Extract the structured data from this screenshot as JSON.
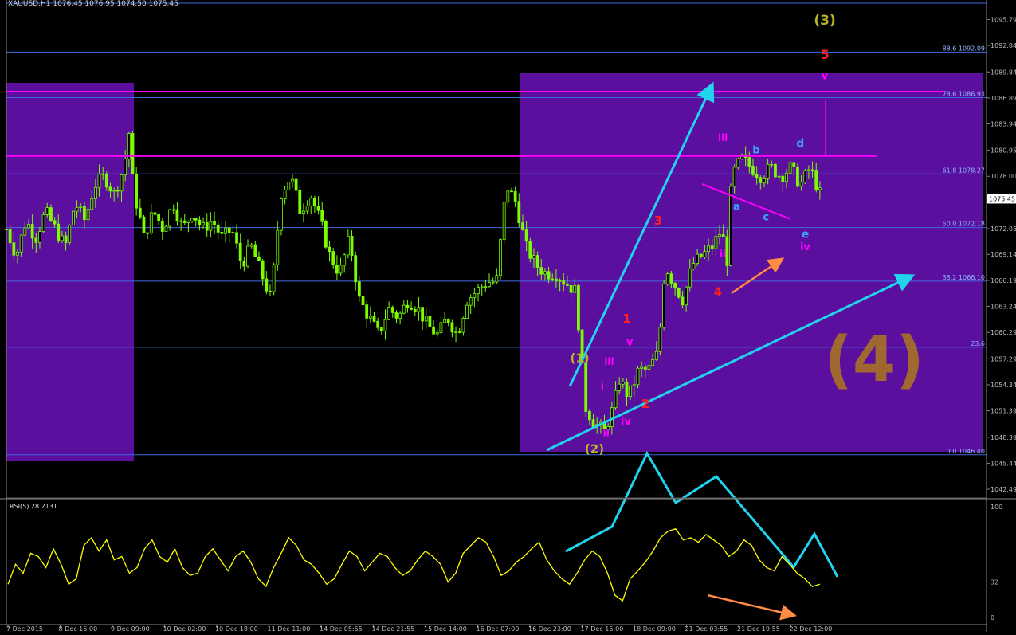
{
  "window": {
    "header": "XAUUSD,H1  1076.45 1076.95 1074.50 1075.45",
    "current_price_tag": "1075.45"
  },
  "colors": {
    "background": "#000000",
    "candles": "#7CFC00",
    "rsi_line": "#FFFF00",
    "zone_fill": "#5B0F9E",
    "fib_line": "#4169E1",
    "magenta": "#FF00FF",
    "cyan": "#22D3EE",
    "orange": "#FF8C42",
    "red_label": "#FF2020",
    "olive_label": "#B5B52A",
    "blue_label": "#3BA0FF",
    "brown_text": "#B8860B"
  },
  "chart_data": [
    {
      "type": "candlestick",
      "symbol": "XAUUSD",
      "timeframe": "H1",
      "title": "XAUUSD,H1  1076.45 1076.95 1074.50 1075.45",
      "ohlc_last": {
        "open": 1076.45,
        "high": 1076.95,
        "low": 1074.5,
        "close": 1075.45
      },
      "ylim": [
        1041.5,
        1098.0
      ],
      "y_ticks": [
        "1095.79",
        "1092.84",
        "1089.84",
        "1086.89",
        "1083.94",
        "1080.95",
        "1078.00",
        "1075.45",
        "1072.05",
        "1069.14",
        "1066.19",
        "1063.24",
        "1060.29",
        "1057.29",
        "1054.34",
        "1051.39",
        "1048.39",
        "1045.44",
        "1042.49"
      ],
      "x_ticks": [
        "7 Dec 2015",
        "8 Dec 16:00",
        "9 Dec 09:00",
        "10 Dec 02:00",
        "10 Dec 18:00",
        "11 Dec 11:00",
        "14 Dec 05:55",
        "14 Dec 21:55",
        "15 Dec 14:00",
        "16 Dec 07:00",
        "16 Dec 23:00",
        "17 Dec 16:00",
        "18 Dec 09:00",
        "21 Dec 03:55",
        "21 Dec 19:55",
        "22 Dec 12:00"
      ],
      "fib_levels": [
        {
          "label": "88.6 1092.09",
          "price": 1092.09
        },
        {
          "label": "78.6 1086.93",
          "price": 1086.93
        },
        {
          "label": "61.8 1078.27",
          "price": 1078.27
        },
        {
          "label": "50.0 1072.18",
          "price": 1072.18
        },
        {
          "label": "38.2 1066.10",
          "price": 1066.1
        },
        {
          "label": "23.6",
          "price": 1058.6
        },
        {
          "label": "0.0 1046.40",
          "price": 1046.4
        }
      ],
      "horizontal_lines": [
        {
          "price": 1087.6,
          "color": "magenta"
        },
        {
          "price": 1080.3,
          "color": "magenta"
        }
      ],
      "path": [
        {
          "x": 0.0,
          "p": 1072
        },
        {
          "x": 0.01,
          "p": 1069
        },
        {
          "x": 0.02,
          "p": 1073
        },
        {
          "x": 0.03,
          "p": 1071
        },
        {
          "x": 0.04,
          "p": 1074
        },
        {
          "x": 0.05,
          "p": 1072
        },
        {
          "x": 0.06,
          "p": 1070
        },
        {
          "x": 0.07,
          "p": 1075
        },
        {
          "x": 0.08,
          "p": 1073
        },
        {
          "x": 0.09,
          "p": 1077
        },
        {
          "x": 0.1,
          "p": 1078
        },
        {
          "x": 0.11,
          "p": 1076
        },
        {
          "x": 0.12,
          "p": 1079
        },
        {
          "x": 0.125,
          "p": 1083
        },
        {
          "x": 0.13,
          "p": 1076
        },
        {
          "x": 0.135,
          "p": 1074
        },
        {
          "x": 0.14,
          "p": 1071
        },
        {
          "x": 0.15,
          "p": 1074
        },
        {
          "x": 0.16,
          "p": 1072
        },
        {
          "x": 0.17,
          "p": 1075
        },
        {
          "x": 0.18,
          "p": 1072
        },
        {
          "x": 0.19,
          "p": 1074
        },
        {
          "x": 0.2,
          "p": 1072
        },
        {
          "x": 0.21,
          "p": 1073
        },
        {
          "x": 0.22,
          "p": 1071
        },
        {
          "x": 0.23,
          "p": 1072
        },
        {
          "x": 0.24,
          "p": 1068
        },
        {
          "x": 0.25,
          "p": 1070
        },
        {
          "x": 0.26,
          "p": 1067
        },
        {
          "x": 0.27,
          "p": 1064
        },
        {
          "x": 0.28,
          "p": 1076
        },
        {
          "x": 0.29,
          "p": 1078
        },
        {
          "x": 0.3,
          "p": 1074
        },
        {
          "x": 0.31,
          "p": 1076
        },
        {
          "x": 0.32,
          "p": 1073
        },
        {
          "x": 0.33,
          "p": 1069
        },
        {
          "x": 0.34,
          "p": 1067
        },
        {
          "x": 0.35,
          "p": 1071
        },
        {
          "x": 0.36,
          "p": 1064
        },
        {
          "x": 0.37,
          "p": 1062
        },
        {
          "x": 0.38,
          "p": 1060
        },
        {
          "x": 0.39,
          "p": 1063
        },
        {
          "x": 0.4,
          "p": 1062
        },
        {
          "x": 0.41,
          "p": 1064
        },
        {
          "x": 0.42,
          "p": 1063
        },
        {
          "x": 0.43,
          "p": 1061
        },
        {
          "x": 0.44,
          "p": 1060
        },
        {
          "x": 0.45,
          "p": 1062
        },
        {
          "x": 0.46,
          "p": 1060
        },
        {
          "x": 0.47,
          "p": 1064
        },
        {
          "x": 0.48,
          "p": 1065
        },
        {
          "x": 0.49,
          "p": 1066
        },
        {
          "x": 0.5,
          "p": 1066
        },
        {
          "x": 0.51,
          "p": 1077
        },
        {
          "x": 0.52,
          "p": 1075
        },
        {
          "x": 0.53,
          "p": 1070
        },
        {
          "x": 0.54,
          "p": 1068
        },
        {
          "x": 0.55,
          "p": 1067
        },
        {
          "x": 0.56,
          "p": 1067
        },
        {
          "x": 0.57,
          "p": 1066
        },
        {
          "x": 0.58,
          "p": 1065
        },
        {
          "x": 0.585,
          "p": 1060
        },
        {
          "x": 0.59,
          "p": 1052
        },
        {
          "x": 0.6,
          "p": 1050
        },
        {
          "x": 0.61,
          "p": 1049
        },
        {
          "x": 0.62,
          "p": 1052
        },
        {
          "x": 0.625,
          "p": 1055
        },
        {
          "x": 0.635,
          "p": 1053
        },
        {
          "x": 0.645,
          "p": 1056
        },
        {
          "x": 0.655,
          "p": 1056
        },
        {
          "x": 0.665,
          "p": 1058
        },
        {
          "x": 0.672,
          "p": 1068
        },
        {
          "x": 0.68,
          "p": 1066
        },
        {
          "x": 0.69,
          "p": 1064
        },
        {
          "x": 0.7,
          "p": 1068
        },
        {
          "x": 0.71,
          "p": 1069
        },
        {
          "x": 0.72,
          "p": 1070
        },
        {
          "x": 0.73,
          "p": 1072
        },
        {
          "x": 0.735,
          "p": 1068
        },
        {
          "x": 0.74,
          "p": 1078
        },
        {
          "x": 0.75,
          "p": 1080
        },
        {
          "x": 0.76,
          "p": 1079
        },
        {
          "x": 0.77,
          "p": 1078
        },
        {
          "x": 0.78,
          "p": 1079
        },
        {
          "x": 0.79,
          "p": 1078
        },
        {
          "x": 0.8,
          "p": 1079
        },
        {
          "x": 0.81,
          "p": 1077
        },
        {
          "x": 0.82,
          "p": 1079
        },
        {
          "x": 0.83,
          "p": 1076
        }
      ],
      "labels": [
        {
          "text": "(3)",
          "price": 1095.2,
          "x_frac": 0.835,
          "color": "olive_label",
          "size": 17
        },
        {
          "text": "5",
          "price": 1091.3,
          "x_frac": 0.835,
          "color": "red_label",
          "size": 16
        },
        {
          "text": "v",
          "price": 1089.0,
          "x_frac": 0.835,
          "color": "magenta",
          "size": 13
        },
        {
          "text": "iii",
          "price": 1082.0,
          "x_frac": 0.731,
          "color": "magenta",
          "size": 12
        },
        {
          "text": "b",
          "price": 1080.6,
          "x_frac": 0.765,
          "color": "blue_label",
          "size": 13
        },
        {
          "text": "d",
          "price": 1081.3,
          "x_frac": 0.81,
          "color": "blue_label",
          "size": 14
        },
        {
          "text": "a",
          "price": 1074.2,
          "x_frac": 0.745,
          "color": "blue_label",
          "size": 13
        },
        {
          "text": "c",
          "price": 1073.0,
          "x_frac": 0.775,
          "color": "blue_label",
          "size": 13
        },
        {
          "text": "e",
          "price": 1071.0,
          "x_frac": 0.815,
          "color": "blue_label",
          "size": 14
        },
        {
          "text": "iv",
          "price": 1069.6,
          "x_frac": 0.815,
          "color": "magenta",
          "size": 13
        },
        {
          "text": "3",
          "price": 1072.5,
          "x_frac": 0.665,
          "color": "red_label",
          "size": 15
        },
        {
          "text": "ii",
          "price": 1068.8,
          "x_frac": 0.731,
          "color": "magenta",
          "size": 12
        },
        {
          "text": "4",
          "price": 1064.4,
          "x_frac": 0.726,
          "color": "red_label",
          "size": 15
        },
        {
          "text": "1",
          "price": 1061.4,
          "x_frac": 0.633,
          "color": "red_label",
          "size": 15
        },
        {
          "text": "v",
          "price": 1058.8,
          "x_frac": 0.636,
          "color": "magenta",
          "size": 13
        },
        {
          "text": "(1)",
          "price": 1056.9,
          "x_frac": 0.585,
          "color": "olive_label",
          "size": 15
        },
        {
          "text": "iii",
          "price": 1056.6,
          "x_frac": 0.615,
          "color": "magenta",
          "size": 12
        },
        {
          "text": "i",
          "price": 1053.8,
          "x_frac": 0.608,
          "color": "magenta",
          "size": 12
        },
        {
          "text": "2",
          "price": 1051.7,
          "x_frac": 0.652,
          "color": "red_label",
          "size": 15
        },
        {
          "text": "iv",
          "price": 1049.8,
          "x_frac": 0.632,
          "color": "magenta",
          "size": 13
        },
        {
          "text": "ii",
          "price": 1048.5,
          "x_frac": 0.612,
          "color": "magenta",
          "size": 12
        },
        {
          "text": "(2)",
          "price": 1046.6,
          "x_frac": 0.6,
          "color": "olive_label",
          "size": 15
        }
      ],
      "big_annotation": "(4)"
    },
    {
      "type": "line",
      "indicator": "RSI",
      "period": 5,
      "title": "RSI(5) 28.2131",
      "value_last": 28.2131,
      "ylim": [
        0,
        100
      ],
      "y_ticks": [
        "100",
        "32",
        "0"
      ],
      "level": 32,
      "series": [
        {
          "values": [
            30,
            48,
            40,
            58,
            55,
            45,
            62,
            48,
            30,
            35,
            65,
            72,
            60,
            70,
            52,
            55,
            40,
            45,
            62,
            70,
            55,
            50,
            62,
            45,
            38,
            40,
            55,
            62,
            52,
            42,
            55,
            60,
            50,
            35,
            28,
            45,
            58,
            72,
            65,
            52,
            48,
            40,
            30,
            35,
            48,
            60,
            55,
            42,
            50,
            58,
            55,
            45,
            38,
            42,
            52,
            60,
            55,
            48,
            32,
            40,
            58,
            65,
            72,
            68,
            55,
            38,
            42,
            50,
            55,
            62,
            68,
            52,
            42,
            35,
            30,
            40,
            52,
            60,
            55,
            40,
            20,
            15,
            35,
            42,
            50,
            60,
            72,
            78,
            80,
            70,
            72,
            68,
            75,
            70,
            65,
            55,
            60,
            70,
            65,
            52,
            45,
            42,
            55,
            48,
            40,
            35,
            28,
            30
          ]
        }
      ]
    }
  ]
}
